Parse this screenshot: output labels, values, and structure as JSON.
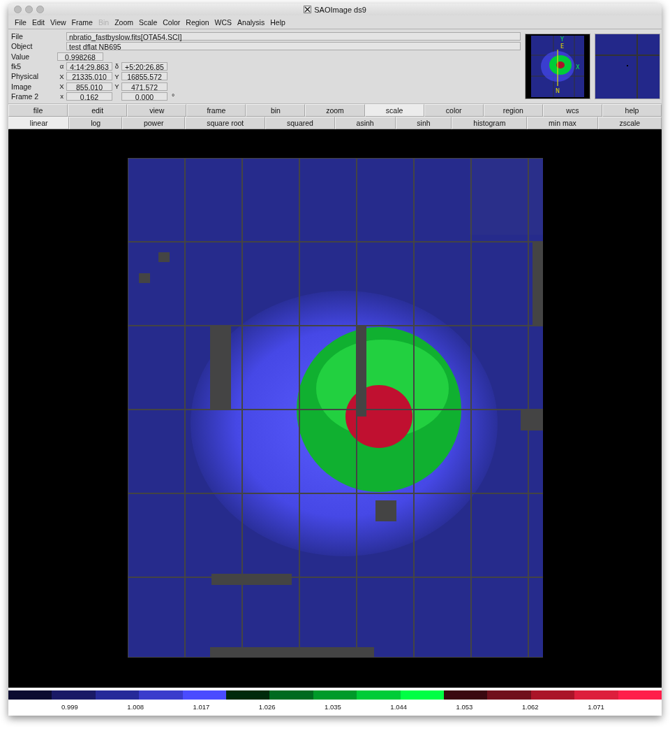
{
  "window": {
    "title": "SAOImage ds9"
  },
  "menu": [
    {
      "label": "File",
      "disabled": false
    },
    {
      "label": "Edit",
      "disabled": false
    },
    {
      "label": "View",
      "disabled": false
    },
    {
      "label": "Frame",
      "disabled": false
    },
    {
      "label": "Bin",
      "disabled": true
    },
    {
      "label": "Zoom",
      "disabled": false
    },
    {
      "label": "Scale",
      "disabled": false
    },
    {
      "label": "Color",
      "disabled": false
    },
    {
      "label": "Region",
      "disabled": false
    },
    {
      "label": "WCS",
      "disabled": false
    },
    {
      "label": "Analysis",
      "disabled": false
    },
    {
      "label": "Help",
      "disabled": false
    }
  ],
  "info": [
    {
      "kind": "wide",
      "label": "File",
      "value": "nbratio_fastbyslow.fits[OTA54.SCI]"
    },
    {
      "kind": "wide",
      "label": "Object",
      "value": "test dflat NB695"
    },
    {
      "kind": "single",
      "label": "Value",
      "value": "0.998268"
    },
    {
      "kind": "pair",
      "label": "fk5",
      "sym1": "α",
      "value": "4:14:29.863",
      "sym2": "δ",
      "value2": "+5:20:26.85"
    },
    {
      "kind": "pair",
      "label": "Physical",
      "sym1": "X",
      "value": "21335.010",
      "sym2": "Y",
      "value2": "16855.572"
    },
    {
      "kind": "pair",
      "label": "Image",
      "sym1": "X",
      "value": "855.010",
      "sym2": "Y",
      "value2": "471.572"
    },
    {
      "kind": "pair",
      "label": "Frame 2",
      "sym1": "x",
      "value": "0.162",
      "value2": "0.000",
      "unit": "°"
    }
  ],
  "buttons": [
    {
      "label": "file",
      "selected": false
    },
    {
      "label": "edit",
      "selected": false
    },
    {
      "label": "view",
      "selected": false
    },
    {
      "label": "frame",
      "selected": false
    },
    {
      "label": "bin",
      "selected": false
    },
    {
      "label": "zoom",
      "selected": false
    },
    {
      "label": "scale",
      "selected": true
    },
    {
      "label": "color",
      "selected": false
    },
    {
      "label": "region",
      "selected": false
    },
    {
      "label": "wcs",
      "selected": false
    },
    {
      "label": "help",
      "selected": false
    }
  ],
  "scale_buttons": [
    {
      "label": "linear",
      "selected": true
    },
    {
      "label": "log",
      "selected": false
    },
    {
      "label": "power",
      "selected": false
    },
    {
      "label": "square root",
      "selected": false
    },
    {
      "label": "squared",
      "selected": false
    },
    {
      "label": "asinh",
      "selected": false
    },
    {
      "label": "sinh",
      "selected": false
    },
    {
      "label": "histogram",
      "selected": false
    },
    {
      "label": "min max",
      "selected": false
    },
    {
      "label": "zscale",
      "selected": false
    }
  ],
  "panner": {
    "compass": [
      "Y",
      "E",
      "N",
      "X"
    ]
  },
  "colorbar": {
    "segments": [
      {
        "color": "#0c0c30"
      },
      {
        "color": "#1a1a66"
      },
      {
        "color": "#262a99"
      },
      {
        "color": "#3a3ccc"
      },
      {
        "color": "#4a4cff"
      },
      {
        "color": "#002a0c"
      },
      {
        "color": "#006a20"
      },
      {
        "color": "#009a2a"
      },
      {
        "color": "#00cc38"
      },
      {
        "color": "#00ff44"
      },
      {
        "color": "#3a0810"
      },
      {
        "color": "#70101c"
      },
      {
        "color": "#aa1428"
      },
      {
        "color": "#dd1e3c"
      },
      {
        "color": "#ff1e4a"
      }
    ],
    "ticks": [
      "0.999",
      "1.008",
      "1.017",
      "1.026",
      "1.035",
      "1.044",
      "1.053",
      "1.062",
      "1.071"
    ]
  }
}
